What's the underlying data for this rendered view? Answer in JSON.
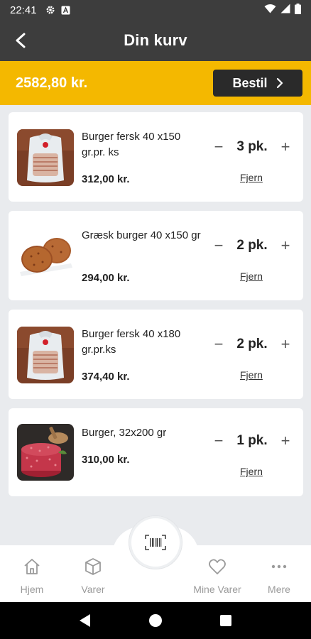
{
  "status_bar": {
    "time": "22:41",
    "icons": [
      "gear-icon",
      "a-icon",
      "wifi-icon",
      "signal-icon",
      "battery-icon"
    ]
  },
  "header": {
    "title": "Din kurv",
    "back_icon": "back-arrow-icon"
  },
  "total_bar": {
    "amount": "2582,80 kr.",
    "order_label": "Bestil",
    "background": "#f4b800"
  },
  "items": [
    {
      "name": "Burger fersk 40 x150 gr.pr. ks",
      "price": "312,00 kr.",
      "quantity": "3 pk.",
      "remove_label": "Fjern",
      "minus": "−",
      "plus": "+"
    },
    {
      "name": "Græsk burger 40 x150 gr",
      "price": "294,00 kr.",
      "quantity": "2 pk.",
      "remove_label": "Fjern",
      "minus": "−",
      "plus": "+"
    },
    {
      "name": "Burger fersk 40 x180 gr.pr.ks",
      "price": "374,40 kr.",
      "quantity": "2 pk.",
      "remove_label": "Fjern",
      "minus": "−",
      "plus": "+"
    },
    {
      "name": "Burger, 32x200 gr",
      "price": "310,00 kr.",
      "quantity": "1 pk.",
      "remove_label": "Fjern",
      "minus": "−",
      "plus": "+"
    }
  ],
  "bottom_nav": {
    "items": [
      {
        "label": "Hjem",
        "icon": "home-icon"
      },
      {
        "label": "Varer",
        "icon": "box-icon"
      },
      {
        "label": "Mine Varer",
        "icon": "heart-icon"
      },
      {
        "label": "Mere",
        "icon": "more-icon"
      }
    ],
    "scan_icon": "barcode-icon"
  },
  "colors": {
    "header": "#3d3d3d",
    "accent": "#f4b800",
    "button_dark": "#2a2a2a"
  }
}
